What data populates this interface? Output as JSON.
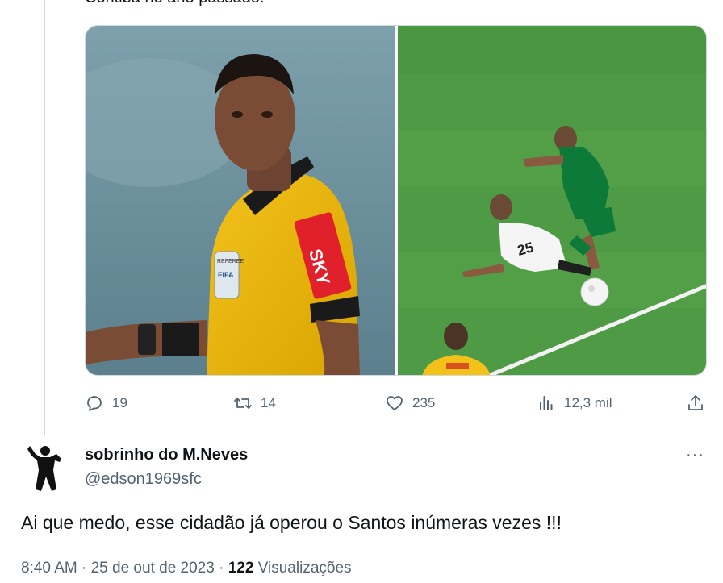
{
  "previous_tweet": {
    "cut_text": "Coritiba no ano passado.",
    "media": [
      {
        "alt_icon": "referee-photo"
      },
      {
        "alt_icon": "football-foul-photo"
      }
    ],
    "badge_text": {
      "referee_label": "REFEREE",
      "fifa_label": "FIFA",
      "sponsor": "SKY"
    },
    "metrics": {
      "replies": "19",
      "reposts": "14",
      "likes": "235",
      "views": "12,3 mil"
    }
  },
  "reply": {
    "display_name": "sobrinho do M.Neves",
    "handle": "@edson1969sfc",
    "text": "Ai que medo, esse cidadão já operou o Santos inúmeras vezes !!!",
    "time": "8:40 AM",
    "separator": "·",
    "date": "25 de out de 2023",
    "views_count": "122",
    "views_label": "Visualizações",
    "more_label": "···"
  }
}
